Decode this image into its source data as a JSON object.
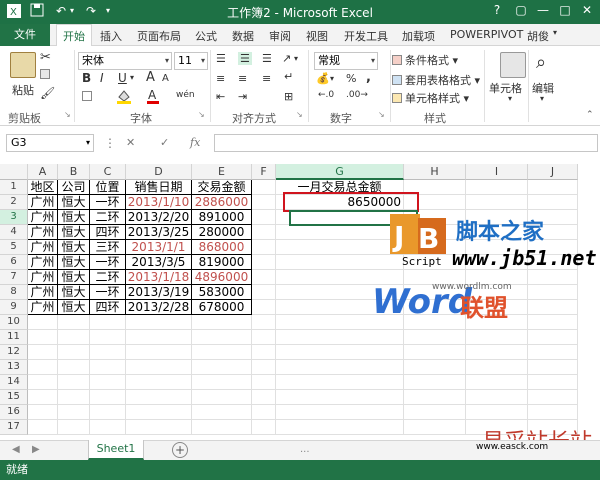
{
  "window": {
    "title": "工作簿2 - Microsoft Excel",
    "controls": {
      "help": "?",
      "restore": "▢",
      "minimize": "—",
      "maximize": "□",
      "close": "✕"
    }
  },
  "ribbon_tabs": [
    "文件",
    "开始",
    "插入",
    "页面布局",
    "公式",
    "数据",
    "审阅",
    "视图",
    "开发工具",
    "加载项",
    "POWERPIVOT"
  ],
  "user_name": "胡俊",
  "ribbon": {
    "clipboard": {
      "paste": "粘贴",
      "group": "剪贴板"
    },
    "font": {
      "name": "宋体",
      "size": "11",
      "bold": "B",
      "italic": "I",
      "underline": "U",
      "grow": "A",
      "shrink": "A",
      "group": "字体",
      "wen": "wén"
    },
    "alignment": {
      "group": "对齐方式"
    },
    "number": {
      "format": "常规",
      "percent": "%",
      "comma": ",",
      "group": "数字"
    },
    "styles": {
      "conditional": "条件格式",
      "table": "套用表格格式",
      "cell": "单元格样式",
      "group": "样式"
    },
    "cells": {
      "label": "单元格"
    },
    "editing": {
      "label": "编辑"
    }
  },
  "formula_bar": {
    "name_box": "G3",
    "cancel": "✕",
    "enter": "✓",
    "fx": "fx",
    "value": ""
  },
  "columns": [
    "A",
    "B",
    "C",
    "D",
    "E",
    "F",
    "G",
    "H",
    "I",
    "J"
  ],
  "rows": [
    "1",
    "2",
    "3",
    "4",
    "5",
    "6",
    "7",
    "8",
    "9",
    "10",
    "11",
    "12",
    "13",
    "14",
    "15",
    "16",
    "17"
  ],
  "sheet": {
    "headers": [
      "地区",
      "公司",
      "位置",
      "销售日期",
      "交易金额"
    ],
    "data": [
      [
        "广州",
        "恒大",
        "一环",
        "2013/1/10",
        "2886000"
      ],
      [
        "广州",
        "恒大",
        "二环",
        "2013/2/20",
        "891000"
      ],
      [
        "广州",
        "恒大",
        "四环",
        "2013/3/25",
        "280000"
      ],
      [
        "广州",
        "恒大",
        "三环",
        "2013/1/1",
        "868000"
      ],
      [
        "广州",
        "恒大",
        "一环",
        "2013/3/5",
        "819000"
      ],
      [
        "广州",
        "恒大",
        "二环",
        "2013/1/18",
        "4896000"
      ],
      [
        "广州",
        "恒大",
        "一环",
        "2013/3/19",
        "583000"
      ],
      [
        "广州",
        "恒大",
        "四环",
        "2013/2/28",
        "678000"
      ]
    ],
    "red_rows": [
      0,
      3,
      5
    ],
    "g1": "一月交易总金额",
    "g2": "8650000"
  },
  "sheet_tabs": {
    "active": "Sheet1",
    "add": "+",
    "prev": "◀",
    "next": "▶",
    "ellipsis": "..."
  },
  "status": "就绪",
  "watermarks": {
    "site1": "脚本之家",
    "site1_url": "www.jb51.net",
    "script": "Script",
    "word_a": "Word",
    "word_b": "联盟",
    "word_url": "www.wordlm.com",
    "yicai": "易采站长站",
    "yicai_url": "www.easck.com"
  },
  "colors": {
    "excel_green": "#217346",
    "title_green": "#1e7145",
    "red_text": "#c0504d",
    "highlight": "#d0141e"
  }
}
